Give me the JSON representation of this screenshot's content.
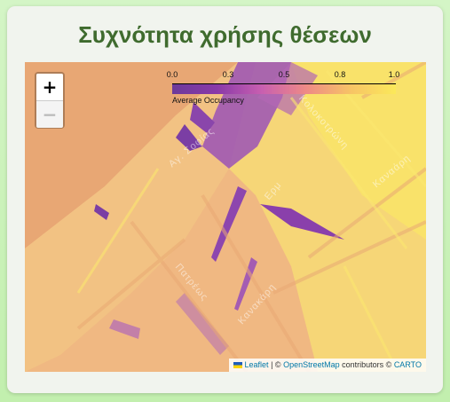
{
  "page": {
    "title": "Συχνότητα χρήσης θέσεων"
  },
  "zoom": {
    "in_label": "+",
    "out_label": "−"
  },
  "legend": {
    "ticks": [
      "0.0",
      "0.3",
      "0.5",
      "0.8",
      "1.0"
    ],
    "caption": "Average Occupancy",
    "colors": [
      "#6d3a9a",
      "#8a3aa8",
      "#c85fb0",
      "#ee8a86",
      "#f7c465",
      "#fbe95a"
    ]
  },
  "attribution": {
    "leaflet": "Leaflet",
    "separator": "|",
    "copyright": "©",
    "osm": "OpenStreetMap",
    "contributors": "contributors ©",
    "carto": "CARTO"
  },
  "street_labels": [
    "Αγ. Σοφίας",
    "Κολοκοτρώνη",
    "Καναάρη",
    "Κανακάρη",
    "Πατρέως",
    "Ερμ"
  ],
  "colors": {
    "title": "#3f6b2e",
    "sea": "#e9a874",
    "accent": "#0078a8"
  }
}
